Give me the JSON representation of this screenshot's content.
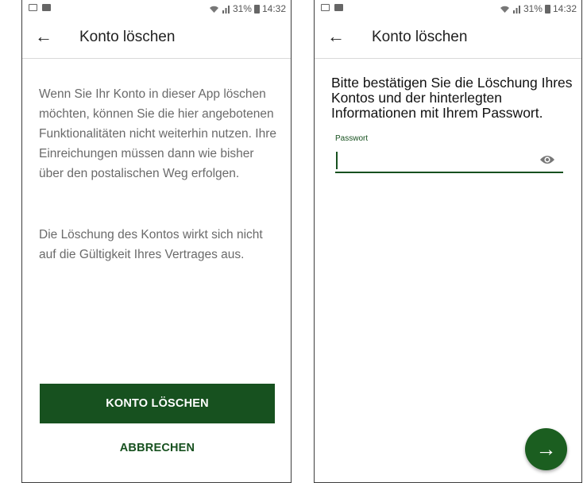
{
  "status_bar": {
    "battery": "31%",
    "time": "14:32"
  },
  "screen1": {
    "title": "Konto löschen",
    "paragraph1": "Wenn Sie Ihr Konto in dieser App löschen möchten, können Sie die hier angebotenen Funktionalitäten nicht weiterhin nutzen. Ihre Einreichungen müssen dann wie bisher über den postalischen Weg erfolgen.",
    "paragraph2": "Die Löschung des Kontos wirkt sich nicht auf die Gültigkeit Ihres Vertrages aus.",
    "delete_button": "KONTO LÖSCHEN",
    "cancel_button": "ABBRECHEN"
  },
  "screen2": {
    "title": "Konto löschen",
    "instruction": "Bitte bestätigen Sie die Löschung Ihres Kontos und der hinterlegten Informationen mit Ihrem Passwort.",
    "password_label": "Passwort",
    "password_value": "",
    "next_icon": "arrow-right-icon"
  },
  "colors": {
    "primary": "#17511f",
    "fab": "#1b5e20"
  }
}
